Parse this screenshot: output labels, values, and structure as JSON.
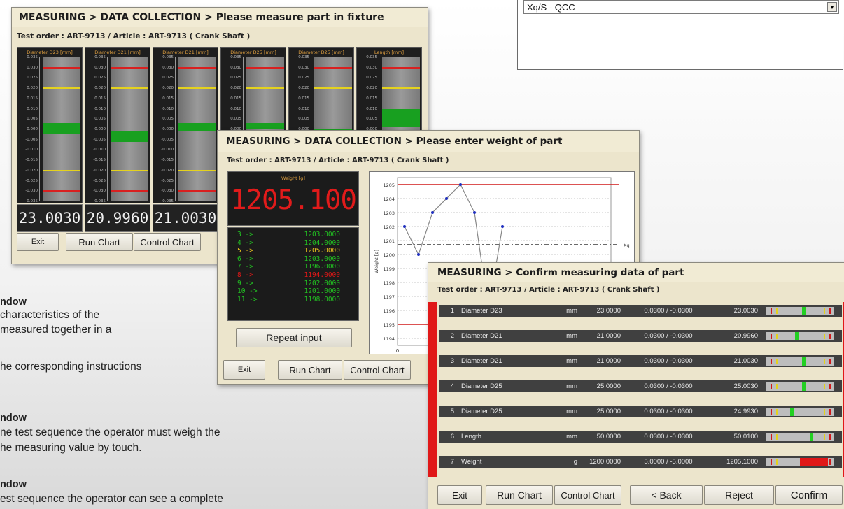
{
  "colors": {
    "title_bg": "#f1ebd4",
    "window_bg": "#ece5cc",
    "alarm_red": "#e01818",
    "ok_green": "#18a020",
    "warn_yellow": "#e4d21e"
  },
  "select": {
    "value": "Xq/S - QCC",
    "arrow_icon": "chevron-down-icon"
  },
  "description": [
    {
      "head": "ndow",
      "lines": [
        "characteristics of the",
        "measured together in a",
        "",
        "he corresponding instructions"
      ]
    },
    {
      "head": "ndow",
      "lines": [
        "ne test sequence the operator must weigh the",
        "he measuring value by touch."
      ]
    },
    {
      "head": "ndow",
      "lines": [
        "est sequence the operator can see a complete"
      ]
    }
  ],
  "measure_window": {
    "title": "MEASURING > DATA COLLECTION > Please measure part in fixture",
    "subtitle": "Test order : ART-9713  /  Article : ART-9713  ( Crank Shaft )",
    "scale_ticks": [
      "0.035",
      "0.030",
      "0.025",
      "0.020",
      "0.015",
      "0.010",
      "0.005",
      "0.000",
      "-0.005",
      "-0.010",
      "-0.015",
      "-0.020",
      "-0.025",
      "-0.030",
      "-0.035"
    ],
    "gauges": [
      {
        "title": "Diameter D23 [mm]",
        "reading": "23.0030",
        "zone": [
          -0.002,
          0.003
        ]
      },
      {
        "title": "Diameter D21 [mm]",
        "reading": "20.9960",
        "zone": [
          -0.006,
          -0.001
        ]
      },
      {
        "title": "Diameter D21 [mm]",
        "reading": "21.0030",
        "zone": [
          -0.001,
          0.003
        ]
      },
      {
        "title": "Diameter D25 [mm]",
        "reading": "",
        "zone": [
          0.0,
          0.003
        ]
      },
      {
        "title": "Diameter D25 [mm]",
        "reading": "",
        "zone": [
          -0.006,
          0.0
        ]
      },
      {
        "title": "Length [mm]",
        "reading": "",
        "zone": [
          0.001,
          0.01
        ]
      }
    ],
    "buttons": {
      "exit": "Exit",
      "run_chart": "Run Chart",
      "control_chart": "Control Chart"
    }
  },
  "weight_window": {
    "title": "MEASURING > DATA COLLECTION > Please enter weight of part",
    "subtitle": "Test order : ART-9713  /  Article : ART-9713  ( Crank Shaft )",
    "weight_label": "Weight [g]",
    "weight_value": "1205.100",
    "history": [
      {
        "idx": "3 ->",
        "value": "1203.0000",
        "color": "#22c022"
      },
      {
        "idx": "4 ->",
        "value": "1204.0000",
        "color": "#22c022"
      },
      {
        "idx": "5 ->",
        "value": "1205.0000",
        "color": "#e8c020"
      },
      {
        "idx": "6 ->",
        "value": "1203.0000",
        "color": "#22c022"
      },
      {
        "idx": "7 ->",
        "value": "1196.0000",
        "color": "#22c022"
      },
      {
        "idx": "8 ->",
        "value": "1194.0000",
        "color": "#e01818"
      },
      {
        "idx": "9 ->",
        "value": "1202.0000",
        "color": "#22c022"
      },
      {
        "idx": "10 ->",
        "value": "1201.0000",
        "color": "#22c022"
      },
      {
        "idx": "11 ->",
        "value": "1198.0000",
        "color": "#22c022"
      }
    ],
    "buttons": {
      "repeat": "Repeat input",
      "exit": "Exit",
      "run_chart": "Run Chart",
      "control_chart": "Control Chart"
    }
  },
  "chart_data": {
    "type": "line",
    "ylabel": "Weight [g]",
    "ylim": [
      1193.5,
      1205.5
    ],
    "yticks": [
      1205,
      1204,
      1203,
      1202,
      1201,
      1200,
      1199,
      1198,
      1197,
      1196,
      1195,
      1194
    ],
    "xtick_labels": [
      "0"
    ],
    "mean_label": "Xq",
    "limits": {
      "usl": 1205,
      "lsl": 1195,
      "mean": 1200.7
    },
    "series": [
      {
        "x": [
          1,
          2,
          3,
          4,
          5,
          6,
          7,
          8
        ],
        "values": [
          1202,
          1200,
          1203,
          1204,
          1205,
          1203,
          1196,
          1202
        ]
      }
    ]
  },
  "confirm_window": {
    "title": "MEASURING > Confirm measuring data of part",
    "subtitle": "Test order : ART-9713  /  Article : ART-9713  ( Crank Shaft )",
    "rows": [
      {
        "num": "1",
        "name": "Diameter D23",
        "unit": "mm",
        "nominal": "23.0000",
        "tolerance": "0.0300 / -0.0300",
        "measured": "23.0030",
        "marker": 0.55,
        "status": "ok"
      },
      {
        "num": "2",
        "name": "Diameter D21",
        "unit": "mm",
        "nominal": "21.0000",
        "tolerance": "0.0300 / -0.0300",
        "measured": "20.9960",
        "marker": 0.45,
        "status": "ok"
      },
      {
        "num": "3",
        "name": "Diameter D21",
        "unit": "mm",
        "nominal": "21.0000",
        "tolerance": "0.0300 / -0.0300",
        "measured": "21.0030",
        "marker": 0.55,
        "status": "ok"
      },
      {
        "num": "4",
        "name": "Diameter D25",
        "unit": "mm",
        "nominal": "25.0000",
        "tolerance": "0.0300 / -0.0300",
        "measured": "25.0030",
        "marker": 0.55,
        "status": "ok"
      },
      {
        "num": "5",
        "name": "Diameter D25",
        "unit": "mm",
        "nominal": "25.0000",
        "tolerance": "0.0300 / -0.0300",
        "measured": "24.9930",
        "marker": 0.38,
        "status": "ok"
      },
      {
        "num": "6",
        "name": "Length",
        "unit": "mm",
        "nominal": "50.0000",
        "tolerance": "0.0300 / -0.0300",
        "measured": "50.0100",
        "marker": 0.67,
        "status": "ok"
      },
      {
        "num": "7",
        "name": "Weight",
        "unit": "g",
        "nominal": "1200.0000",
        "tolerance": "5.0000 / -5.0000",
        "measured": "1205.1000",
        "marker": 1.0,
        "status": "alarm"
      }
    ],
    "buttons": {
      "exit": "Exit",
      "run_chart": "Run Chart",
      "control_chart": "Control Chart",
      "back": "< Back",
      "reject": "Reject",
      "confirm": "Confirm"
    }
  }
}
